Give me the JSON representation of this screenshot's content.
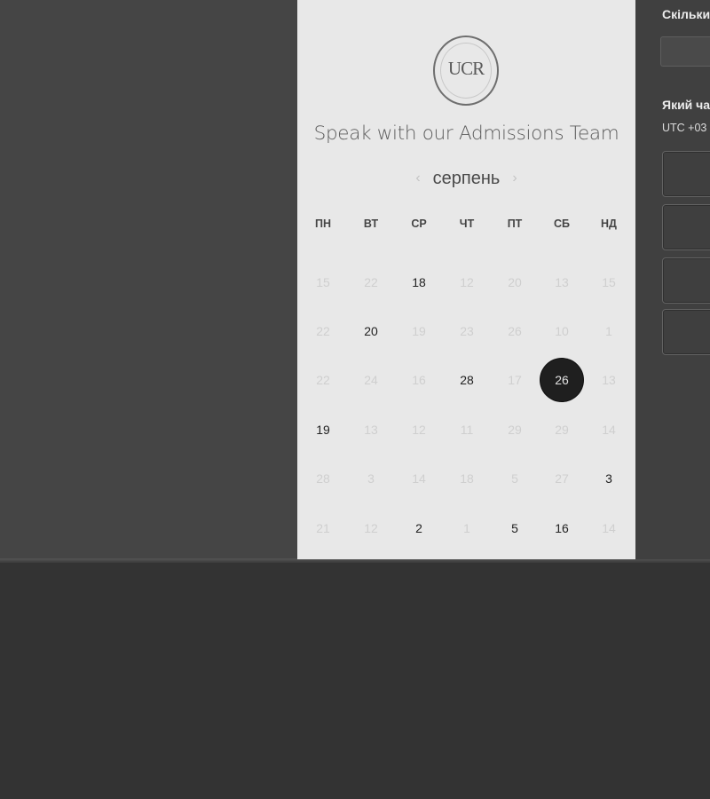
{
  "right_panel": {
    "duration_label": "Скільки",
    "time_label": "Який ча",
    "timezone": "UTC +03"
  },
  "calendar": {
    "logo_text": "UCR",
    "title": "Speak with our Admissions Team",
    "month": "серпень",
    "prev_icon": "chevron-left-icon",
    "next_icon": "chevron-right-icon",
    "weekdays": [
      "ПН",
      "ВТ",
      "СР",
      "ЧТ",
      "ПТ",
      "СБ",
      "НД"
    ],
    "weeks": [
      [
        {
          "t": "15",
          "a": false
        },
        {
          "t": "22",
          "a": false
        },
        {
          "t": "18",
          "a": true
        },
        {
          "t": "12",
          "a": false
        },
        {
          "t": "20",
          "a": false
        },
        {
          "t": "13",
          "a": false
        },
        {
          "t": "15",
          "a": false
        }
      ],
      [
        {
          "t": "22",
          "a": false
        },
        {
          "t": "20",
          "a": true
        },
        {
          "t": "19",
          "a": false
        },
        {
          "t": "23",
          "a": false
        },
        {
          "t": "26",
          "a": false
        },
        {
          "t": "10",
          "a": false
        },
        {
          "t": "1",
          "a": false
        }
      ],
      [
        {
          "t": "22",
          "a": false
        },
        {
          "t": "24",
          "a": false
        },
        {
          "t": "16",
          "a": false
        },
        {
          "t": "28",
          "a": true
        },
        {
          "t": "17",
          "a": false
        },
        {
          "t": "26",
          "a": true,
          "selected": true
        },
        {
          "t": "13",
          "a": false
        }
      ],
      [
        {
          "t": "19",
          "a": true
        },
        {
          "t": "13",
          "a": false
        },
        {
          "t": "12",
          "a": false
        },
        {
          "t": "11",
          "a": false
        },
        {
          "t": "29",
          "a": false
        },
        {
          "t": "29",
          "a": false
        },
        {
          "t": "14",
          "a": false
        }
      ],
      [
        {
          "t": "28",
          "a": false
        },
        {
          "t": "3",
          "a": false
        },
        {
          "t": "14",
          "a": false
        },
        {
          "t": "18",
          "a": false
        },
        {
          "t": "5",
          "a": false
        },
        {
          "t": "27",
          "a": false
        },
        {
          "t": "3",
          "a": true
        }
      ],
      [
        {
          "t": "21",
          "a": false
        },
        {
          "t": "12",
          "a": false
        },
        {
          "t": "2",
          "a": true
        },
        {
          "t": "1",
          "a": false
        },
        {
          "t": "5",
          "a": true
        },
        {
          "t": "16",
          "a": true
        },
        {
          "t": "14",
          "a": false
        }
      ]
    ]
  }
}
